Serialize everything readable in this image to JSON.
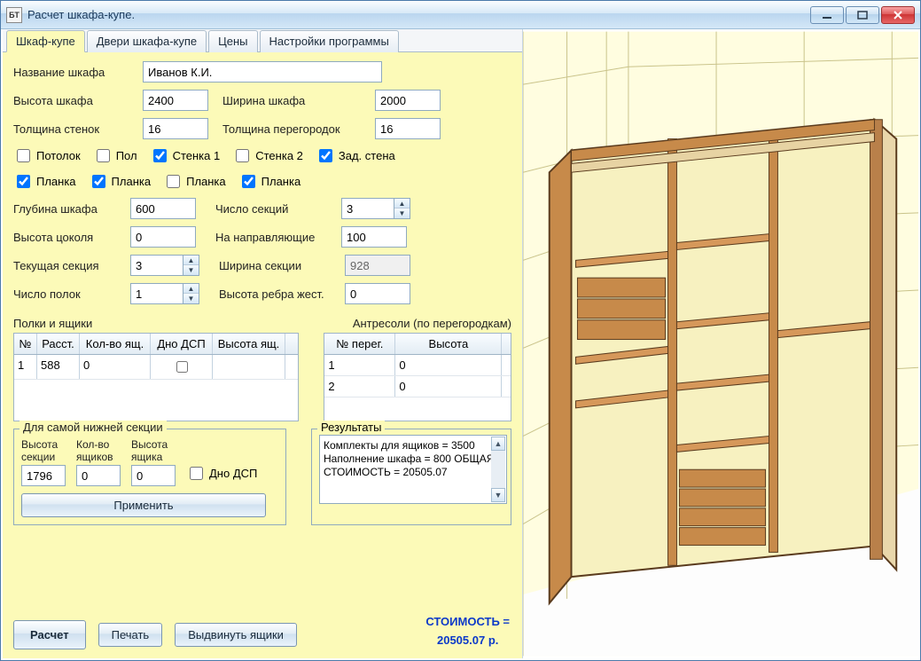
{
  "window": {
    "title": "Расчет шкафа-купе.",
    "icon_text": "БТ"
  },
  "tabs": [
    {
      "label": "Шкаф-купе",
      "active": true
    },
    {
      "label": "Двери шкафа-купе",
      "active": false
    },
    {
      "label": "Цены",
      "active": false
    },
    {
      "label": "Настройки программы",
      "active": false
    }
  ],
  "form": {
    "name_label": "Название шкафа",
    "name_value": "Иванов К.И.",
    "height_label": "Высота шкафа",
    "height_value": "2400",
    "width_label": "Ширина шкафа",
    "width_value": "2000",
    "wall_thick_label": "Толщина стенок",
    "wall_thick_value": "16",
    "part_thick_label": "Толщина перегородок",
    "part_thick_value": "16",
    "chk_ceiling": "Потолок",
    "chk_floor": "Пол",
    "chk_wall1": "Стенка 1",
    "chk_wall2": "Стенка 2",
    "chk_back": "Зад. стена",
    "chk_plank1": "Планка",
    "chk_plank2": "Планка",
    "chk_plank3": "Планка",
    "chk_plank4": "Планка",
    "depth_label": "Глубина шкафа",
    "depth_value": "600",
    "sections_label": "Число секций",
    "sections_value": "3",
    "plinth_height_label": "Высота цоколя",
    "plinth_height_value": "0",
    "rails_label": "На направляющие",
    "rails_value": "100",
    "cur_section_label": "Текущая секция",
    "cur_section_value": "3",
    "section_width_label": "Ширина секции",
    "section_width_value": "928",
    "shelves_label": "Число полок",
    "shelves_value": "1",
    "stiffener_label": "Высота ребра жест.",
    "stiffener_value": "0"
  },
  "shelves_grid": {
    "caption": "Полки и ящики",
    "headers": [
      "№",
      "Расст.",
      "Кол-во ящ.",
      "Дно ДСП",
      "Высота ящ."
    ],
    "rows": [
      {
        "n": "1",
        "dist": "588",
        "qty": "0",
        "dno": false,
        "h": ""
      }
    ]
  },
  "mezz_grid": {
    "caption": "Антресоли (по перегородкам)",
    "headers": [
      "№ перег.",
      "Высота"
    ],
    "rows": [
      {
        "n": "1",
        "h": "0"
      },
      {
        "n": "2",
        "h": "0"
      }
    ]
  },
  "bottom": {
    "group_title": "Для самой нижней секции",
    "h_label": "Высота\nсекции",
    "h_value": "1796",
    "q_label": "Кол-во\nящиков",
    "q_value": "0",
    "bh_label": "Высота\nящика",
    "bh_value": "0",
    "dno_label": "Дно ДСП",
    "apply_label": "Применить"
  },
  "results": {
    "title": "Результаты",
    "lines": [
      "Комплекты для ящиков     = 3500",
      "Наполнение шкафа           = 800",
      "ОБЩАЯ СТОИМОСТЬ          =",
      "20505.07"
    ]
  },
  "buttons": {
    "calc": "Расчет",
    "print": "Печать",
    "extend": "Выдвинуть ящики"
  },
  "price": {
    "label": "СТОИМОСТЬ =",
    "value": "20505.07 р."
  }
}
